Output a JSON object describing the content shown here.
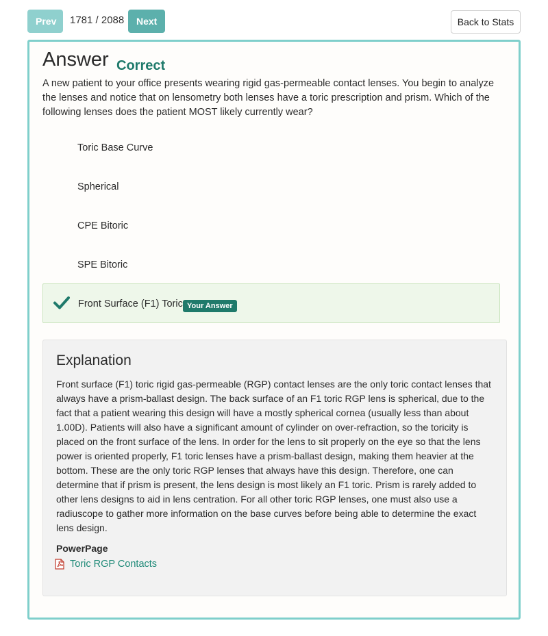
{
  "nav": {
    "prev_label": "Prev",
    "counter": "1781 / 2088",
    "next_label": "Next",
    "back_label": "Back to Stats"
  },
  "answer": {
    "title": "Answer",
    "status": "Correct",
    "status_color": "#1f7a6b",
    "question": "A new patient to your office presents wearing rigid gas-permeable contact lenses. You begin to analyze the lenses and notice that on lensometry both lenses have a toric prescription and prism. Which of the following lenses does the patient MOST likely currently wear?",
    "choices": [
      {
        "label": "Toric Base Curve"
      },
      {
        "label": "Spherical"
      },
      {
        "label": "CPE Bitoric"
      },
      {
        "label": "SPE Bitoric"
      }
    ],
    "selected": {
      "label": "Front Surface (F1) Toric",
      "badge": "Your Answer",
      "icon": "check-icon"
    }
  },
  "explanation": {
    "title": "Explanation",
    "text": "Front surface (F1) toric rigid gas-permeable (RGP) contact lenses are the only toric contact lenses that always have a prism-ballast design. The back surface of an F1 toric RGP lens is spherical, due to the fact that a patient wearing this design will have a mostly spherical cornea (usually less than about 1.00D). Patients will also have a significant amount of cylinder on over-refraction, so the toricity is placed on the front surface of the lens. In order for the lens to sit properly on the eye so that the lens power is oriented properly, F1 toric lenses have a prism-ballast design, making them heavier at the bottom. These are the only toric RGP lenses that always have this design. Therefore, one can determine that if prism is present, the lens design is most likely an F1 toric. Prism is rarely added to other lens designs to aid in lens centration. For all other toric RGP lenses, one must also use a radiuscope to gather more information on the base curves before being able to determine the exact lens design.",
    "powerpage_label": "PowerPage",
    "powerpage_link": "Toric RGP Contacts",
    "link_icon": "pdf-icon"
  },
  "colors": {
    "accent": "#7fcfcb",
    "prev_button": "#8fd0ce",
    "next_button": "#5cb0ac",
    "link": "#1f8a78",
    "selected_bg": "#eef7ea"
  }
}
